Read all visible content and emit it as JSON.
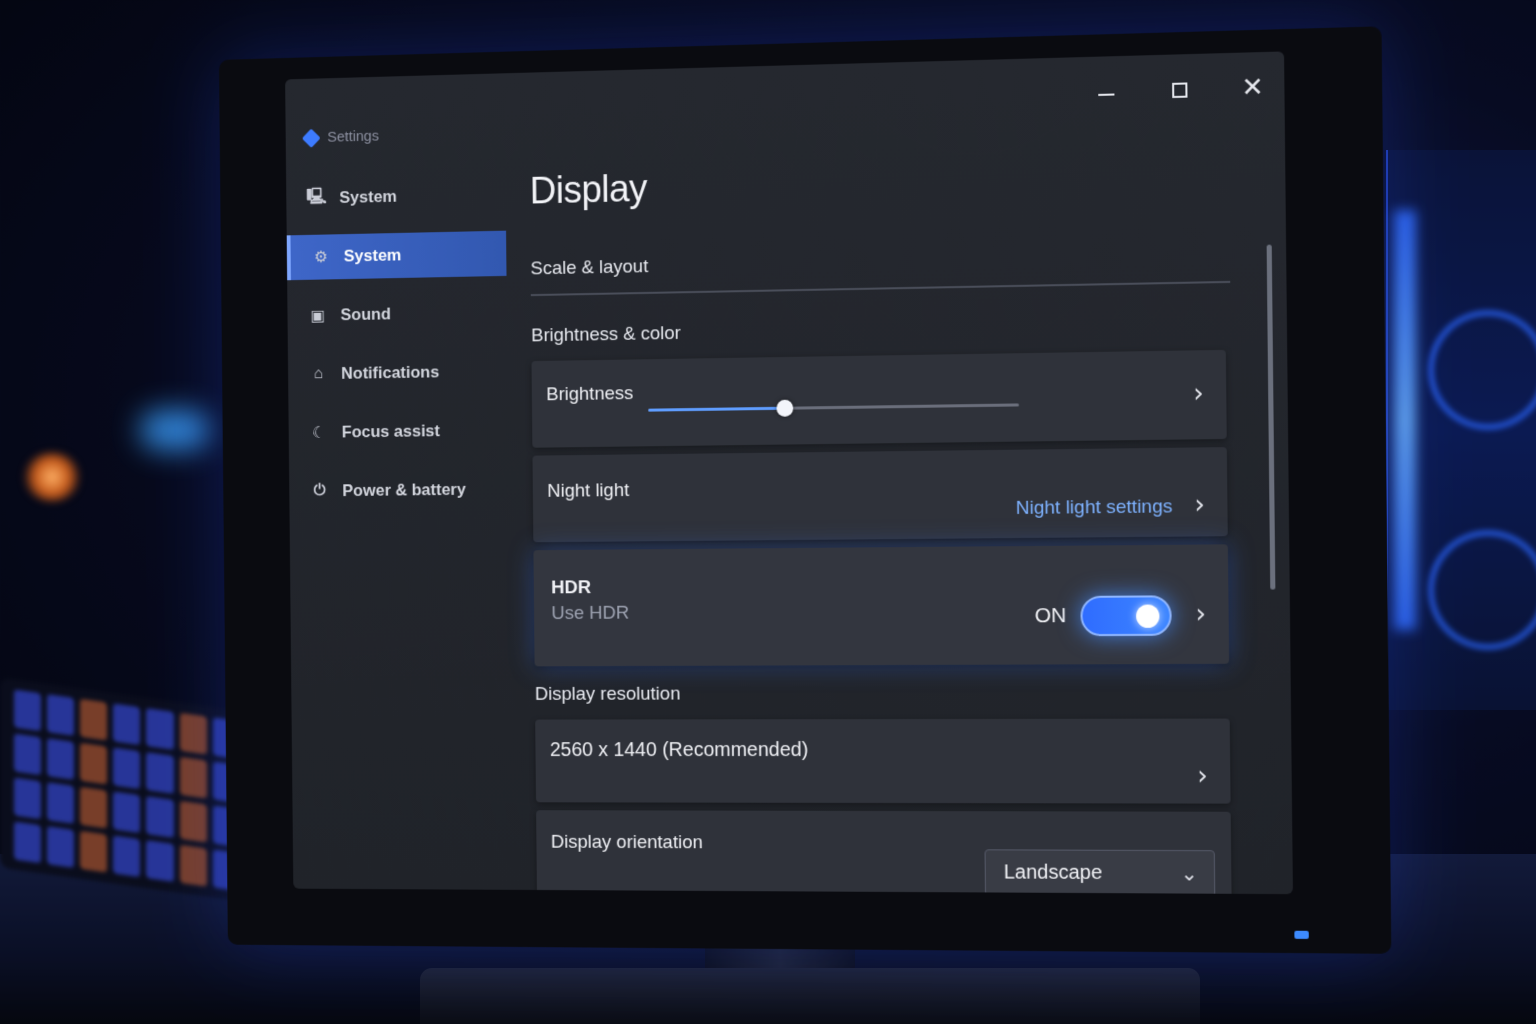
{
  "window": {
    "app_title": "Settings",
    "controls": {
      "minimize_icon": "minimize-icon",
      "maximize_icon": "maximize-icon",
      "close_glyph": "✕"
    }
  },
  "sidebar": {
    "items": [
      {
        "label": "System",
        "icon": "system-icon",
        "glyph": "🖳",
        "active": false
      },
      {
        "label": "System",
        "icon": "display-icon",
        "glyph": "⚙",
        "active": true
      },
      {
        "label": "Sound",
        "icon": "sound-icon",
        "glyph": "▣",
        "active": false
      },
      {
        "label": "Notifications",
        "icon": "notifications-icon",
        "glyph": "⌂",
        "active": false
      },
      {
        "label": "Focus assist",
        "icon": "focus-assist-icon",
        "glyph": "☾",
        "active": false
      },
      {
        "label": "Power & battery",
        "icon": "power-icon",
        "glyph": "⏻",
        "active": false
      }
    ]
  },
  "main": {
    "title": "Display",
    "scale_layout_label": "Scale & layout",
    "brightness_color_label": "Brightness & color",
    "brightness": {
      "label": "Brightness",
      "value": 0.37
    },
    "night_light": {
      "label": "Night light",
      "link": "Night light settings"
    },
    "hdr": {
      "title": "HDR",
      "subtitle": "Use HDR",
      "state_label": "ON",
      "on": true
    },
    "resolution_label": "Display resolution",
    "resolution": {
      "value": "2560 x 1440 (Recommended)"
    },
    "orientation": {
      "label": "Display orientation",
      "selected": "Landscape"
    },
    "chevron_glyph": "›",
    "dropdown_glyph": "⌄"
  },
  "colors": {
    "accent": "#3d86ff",
    "link": "#7eb2ff",
    "active_nav": "#3e66c8"
  }
}
